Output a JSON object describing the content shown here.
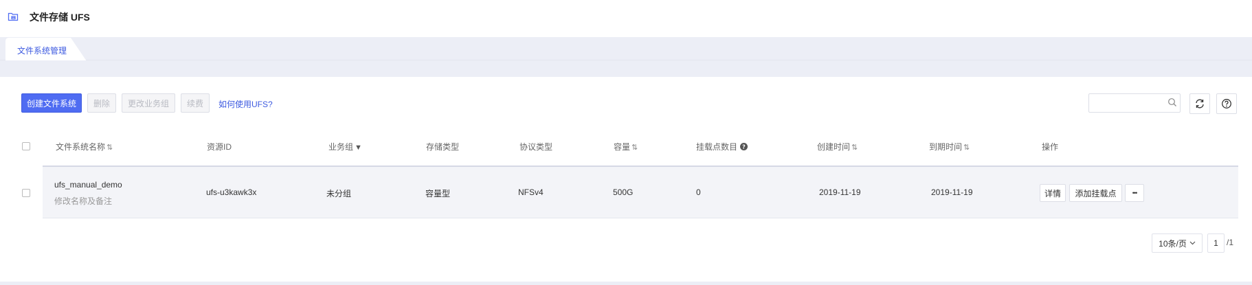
{
  "header": {
    "title": "文件存储 UFS",
    "logo_icon": "storage-folder-icon"
  },
  "tabs": [
    {
      "label": "文件系统管理",
      "active": true
    }
  ],
  "toolbar": {
    "create_label": "创建文件系统",
    "delete_label": "删除",
    "change_group_label": "更改业务组",
    "renew_label": "续费",
    "help_link": "如何使用UFS?",
    "search_placeholder": ""
  },
  "table": {
    "columns": {
      "name": "文件系统名称",
      "resource_id": "资源ID",
      "group": "业务组",
      "storage_type": "存储类型",
      "protocol": "协议类型",
      "capacity": "容量",
      "mount_count": "挂载点数目",
      "created": "创建时间",
      "expires": "到期时间",
      "actions": "操作"
    },
    "rows": [
      {
        "name": "ufs_manual_demo",
        "edit_hint": "修改名称及备注",
        "resource_id": "ufs-u3kawk3x",
        "group": "未分组",
        "storage_type": "容量型",
        "protocol": "NFSv4",
        "capacity": "500G",
        "mount_count": "0",
        "created": "2019-11-19",
        "expires": "2019-11-19",
        "actions": {
          "detail": "详情",
          "add_mount": "添加挂载点",
          "more": "•••"
        }
      }
    ]
  },
  "pagination": {
    "page_size": "10条/页",
    "current_page": "1",
    "total_pages": "/1"
  },
  "colors": {
    "accent": "#4f6cf2",
    "link": "#3d5ae0",
    "band": "#eceef6"
  }
}
